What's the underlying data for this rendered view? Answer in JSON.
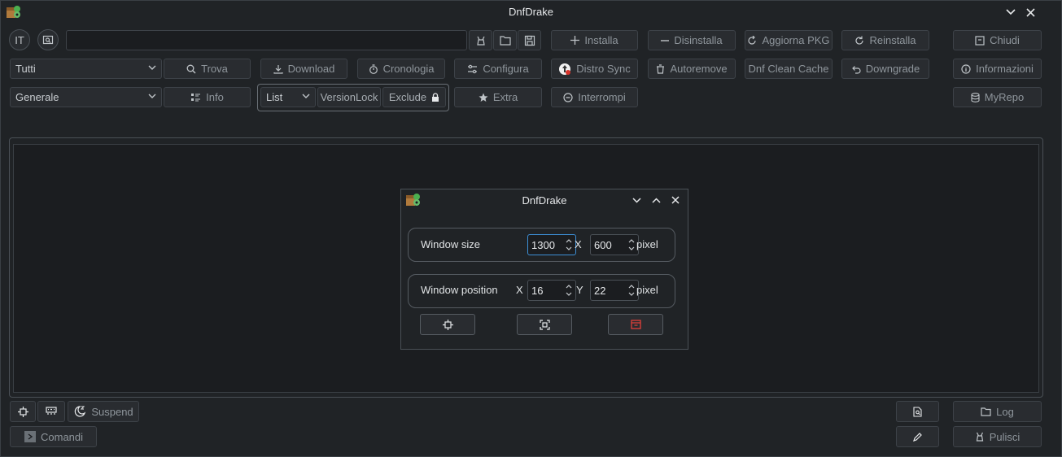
{
  "window": {
    "title": "DnfDrake"
  },
  "toolbar": {
    "lang": "IT",
    "search": {
      "value": "",
      "placeholder": ""
    },
    "row1": [
      "Installa",
      "Disinstalla",
      "Aggiorna PKG",
      "Reinstalla",
      "Chiudi"
    ],
    "row2_combo": "Tutti",
    "row2": [
      "Trova",
      "Download",
      "Cronologia",
      "Configura",
      "Distro Sync",
      "Autoremove",
      "Dnf Clean Cache",
      "Downgrade",
      "Informazioni"
    ],
    "row3_combo": "Generale",
    "info": "Info",
    "list_combo": "List",
    "versionlock": "VersionLock",
    "exclude": "Exclude",
    "extra": "Extra",
    "interrompi": "Interrompi",
    "myrepo": "MyRepo"
  },
  "bottom": {
    "suspend": "Suspend",
    "comandi": "Comandi",
    "log": "Log",
    "pulisci": "Pulisci"
  },
  "dialog": {
    "title": "DnfDrake",
    "size_label": "Window size",
    "size_w": "1300",
    "size_sep": "X",
    "size_h": "600",
    "size_unit": "pixel",
    "pos_label": "Window position",
    "pos_x_label": "X",
    "pos_x": "16",
    "pos_y_label": "Y",
    "pos_y": "22",
    "pos_unit": "pixel"
  },
  "colors": {
    "accent": "#3d8fd6",
    "danger": "#e0403a",
    "background": "#202326"
  }
}
